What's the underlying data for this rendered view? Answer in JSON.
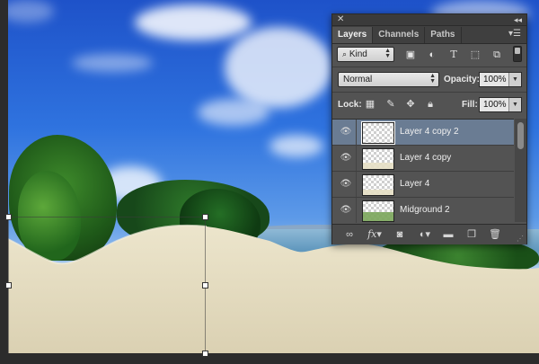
{
  "panel": {
    "tabs": [
      {
        "label": "Layers"
      },
      {
        "label": "Channels"
      },
      {
        "label": "Paths"
      }
    ],
    "filter": {
      "kind_label": "Kind"
    },
    "blend_mode": "Normal",
    "opacity_label": "Opacity:",
    "opacity_value": "100%",
    "lock_label": "Lock:",
    "fill_label": "Fill:",
    "fill_value": "100%",
    "layers": [
      {
        "name": "Layer 4 copy 2",
        "selected": true
      },
      {
        "name": "Layer 4 copy",
        "selected": false
      },
      {
        "name": "Layer 4",
        "selected": false
      },
      {
        "name": "Midground 2",
        "selected": false
      }
    ]
  },
  "colors": {
    "panel_bg": "#535353",
    "selected_row": "#6a7c93",
    "sky_top": "#1e52c9",
    "sand": "#e8e0c5"
  },
  "icons": [
    "close-icon",
    "collapse-icon",
    "panel-menu-icon",
    "search-icon",
    "image-filter-icon",
    "adjustment-filter-icon",
    "type-filter-icon",
    "shape-filter-icon",
    "smart-object-filter-icon",
    "filter-toggle-icon",
    "lock-transparent-icon",
    "lock-pixels-icon",
    "lock-position-icon",
    "lock-all-icon",
    "eye-icon",
    "link-icon",
    "fx-icon",
    "mask-icon",
    "adjustment-layer-icon",
    "group-folder-icon",
    "new-layer-icon",
    "trash-icon"
  ]
}
